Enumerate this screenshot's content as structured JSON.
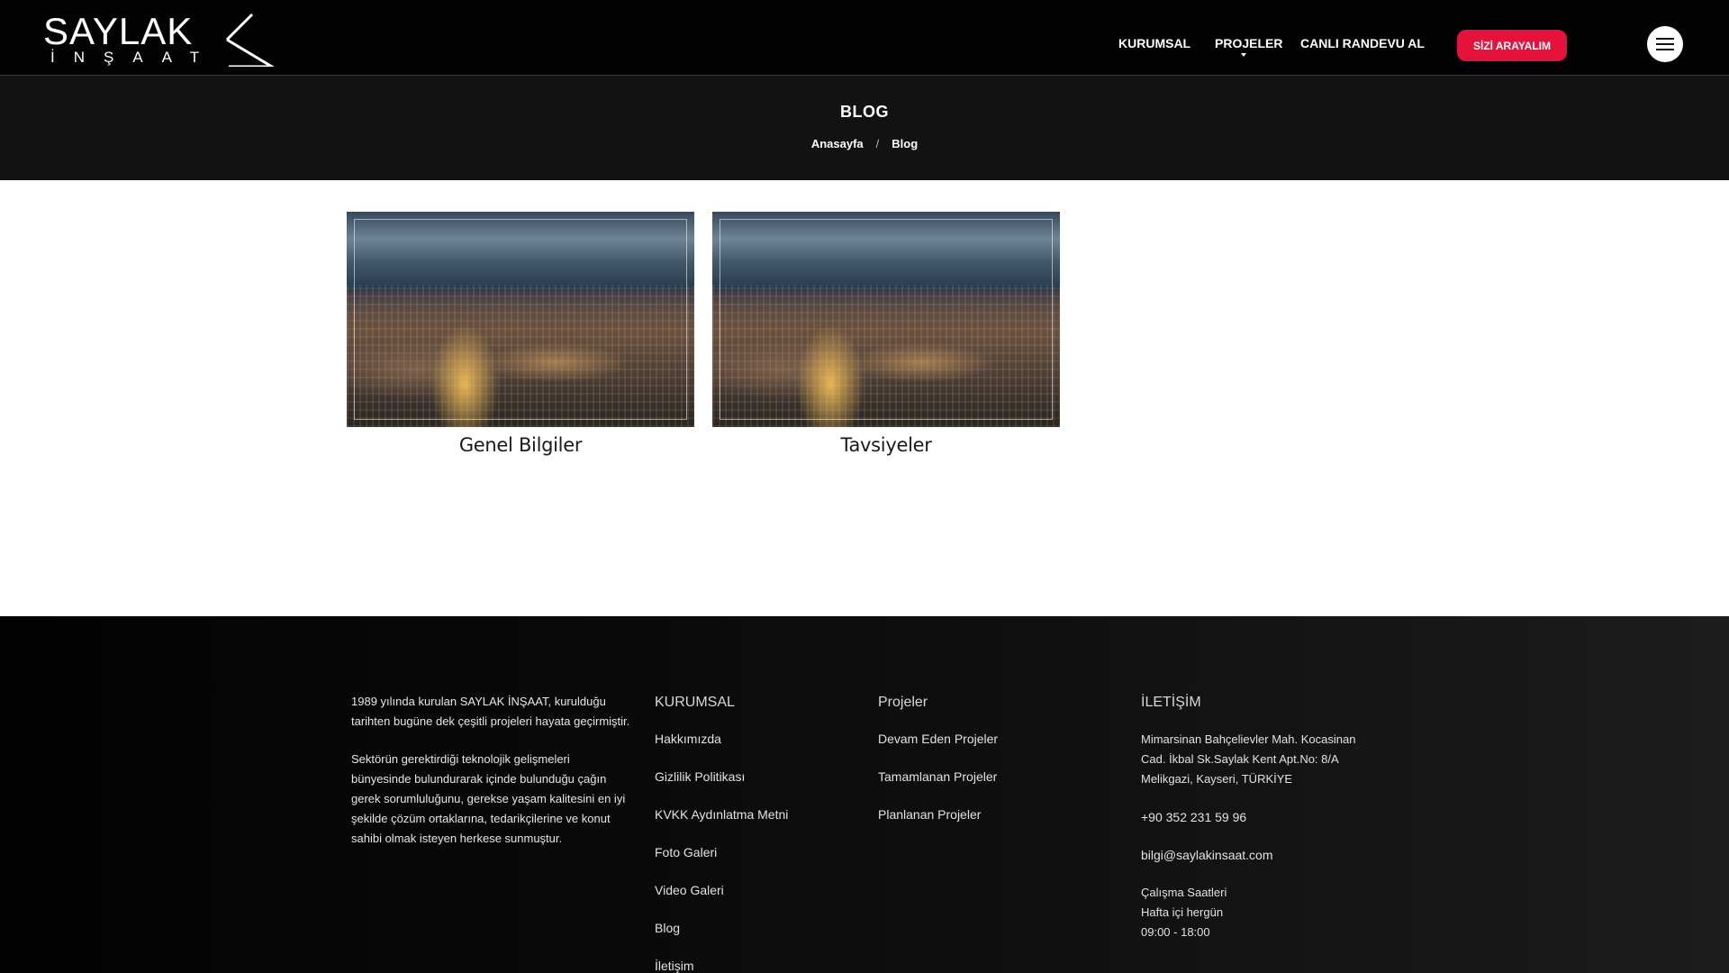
{
  "brand": {
    "name_top": "SAYLAK",
    "name_bottom": "İNŞAAT"
  },
  "nav": {
    "items": [
      "KURUMSAL",
      "PROJELER",
      "CANLI RANDEVU AL"
    ],
    "cta_label": "SİZİ ARAYALIM"
  },
  "page": {
    "title": "BLOG"
  },
  "breadcrumb": {
    "home": "Anasayfa",
    "separator": "/",
    "current": "Blog"
  },
  "cards": [
    {
      "title": "Genel Bilgiler"
    },
    {
      "title": "Tavsiyeler"
    }
  ],
  "footer": {
    "about": [
      "1989 yılında kurulan SAYLAK İNŞAAT, kurulduğu tarihten bugüne dek çeşitli projeleri hayata geçirmiştir.",
      "Sektörün gerektirdiği teknolojik gelişmeleri bünyesinde bulundurarak içinde bulunduğu çağın gerek sorumluluğunu, gerekse yaşam kalitesini en iyi şekilde çözüm ortaklarına, tedarikçilerine ve konut sahibi olmak isteyen herkese sunmuştur."
    ],
    "kurumsal": {
      "heading": "KURUMSAL",
      "links": [
        "Hakkımızda",
        "Gizlilik Politikası",
        "KVKK Aydınlatma Metni",
        "Foto Galeri",
        "Video Galeri",
        "Blog",
        "İletişim"
      ]
    },
    "projeler": {
      "heading": "Projeler",
      "links": [
        "Devam Eden Projeler",
        "Tamamlanan Projeler",
        "Planlanan Projeler"
      ]
    },
    "iletisim": {
      "heading": "İLETİŞİM",
      "address": "Mimarsinan Bahçelievler Mah. Kocasinan Cad. İkbal Sk.Saylak Kent Apt.No: 8/A Melikgazi, Kayseri, TÜRKİYE",
      "phone": "+90 352 231 59 96",
      "email": "bilgi@saylakinsaat.com",
      "hours_label": "Çalışma Saatleri",
      "hours_days": "Hafta içi hergün",
      "hours_time": "09:00 - 18:00"
    }
  }
}
